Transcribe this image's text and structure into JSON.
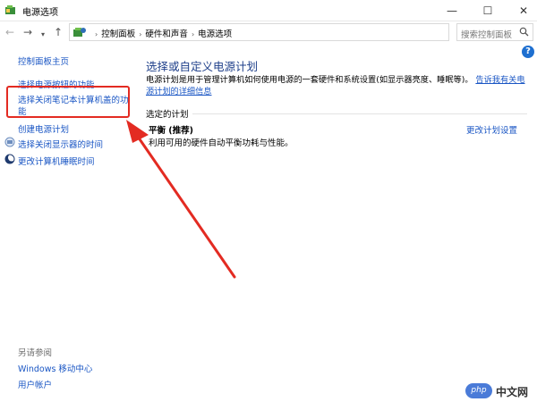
{
  "window": {
    "title": "电源选项",
    "minimize_glyph": "—",
    "maximize_glyph": "☐",
    "close_glyph": "✕"
  },
  "nav": {
    "back_glyph": "←",
    "forward_glyph": "→",
    "history_glyph": "▾",
    "up_glyph": "↑",
    "breadcrumb": [
      "控制面板",
      "硬件和声音",
      "电源选项"
    ],
    "breadcrumb_sep": "›",
    "dropdown_glyph": "▾",
    "refresh_glyph": "↻",
    "search_placeholder": "搜索控制面板"
  },
  "help_glyph": "?",
  "sidebar": {
    "home_link": "控制面板主页",
    "items": [
      {
        "label": "选择电源按钮的功能"
      },
      {
        "label": "选择关闭笔记本计算机盖的功"
      },
      {
        "label": "能"
      },
      {
        "label": "创建电源计划"
      },
      {
        "label": "选择关闭显示器的时间"
      },
      {
        "label": "更改计算机睡眠时间"
      }
    ],
    "see_also_title": "另请参阅",
    "see_also": [
      {
        "label": "Windows 移动中心"
      },
      {
        "label": "用户帐户"
      }
    ]
  },
  "main": {
    "title": "选择或自定义电源计划",
    "description": "电源计划是用于管理计算机如何使用电源的一套硬件和系统设置(如显示器亮度、睡眠等)。",
    "description_link": "告诉我有关电源计划的详细信息",
    "selected_plan_label": "选定的计划",
    "plan": {
      "name": "平衡 (推荐)",
      "description": "利用可用的硬件自动平衡功耗与性能。",
      "change_link": "更改计划设置"
    }
  },
  "annotation": {
    "highlight_color": "#e32b22"
  },
  "watermark": {
    "badge": "php",
    "text": "中文网"
  },
  "colors": {
    "link": "#1a56c4",
    "title": "#1e3f8a",
    "annotation_red": "#e32b22",
    "help_blue": "#1e6fd0"
  }
}
